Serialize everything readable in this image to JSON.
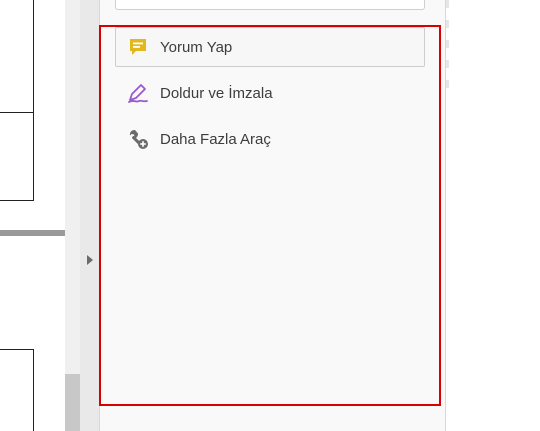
{
  "tools_pane": {
    "items": [
      {
        "label": "Yorum Yap",
        "icon": "comment-icon",
        "icon_color": "#E3B81D",
        "selected": true
      },
      {
        "label": "Doldur ve İmzala",
        "icon": "fill-sign-icon",
        "icon_color": "#9B59D0",
        "selected": false
      },
      {
        "label": "Daha Fazla Araç",
        "icon": "more-tools-icon",
        "icon_color": "#6B6B6B",
        "selected": false
      }
    ]
  },
  "colors": {
    "highlight": "#D90000",
    "pane_background": "#F9F9F9"
  }
}
